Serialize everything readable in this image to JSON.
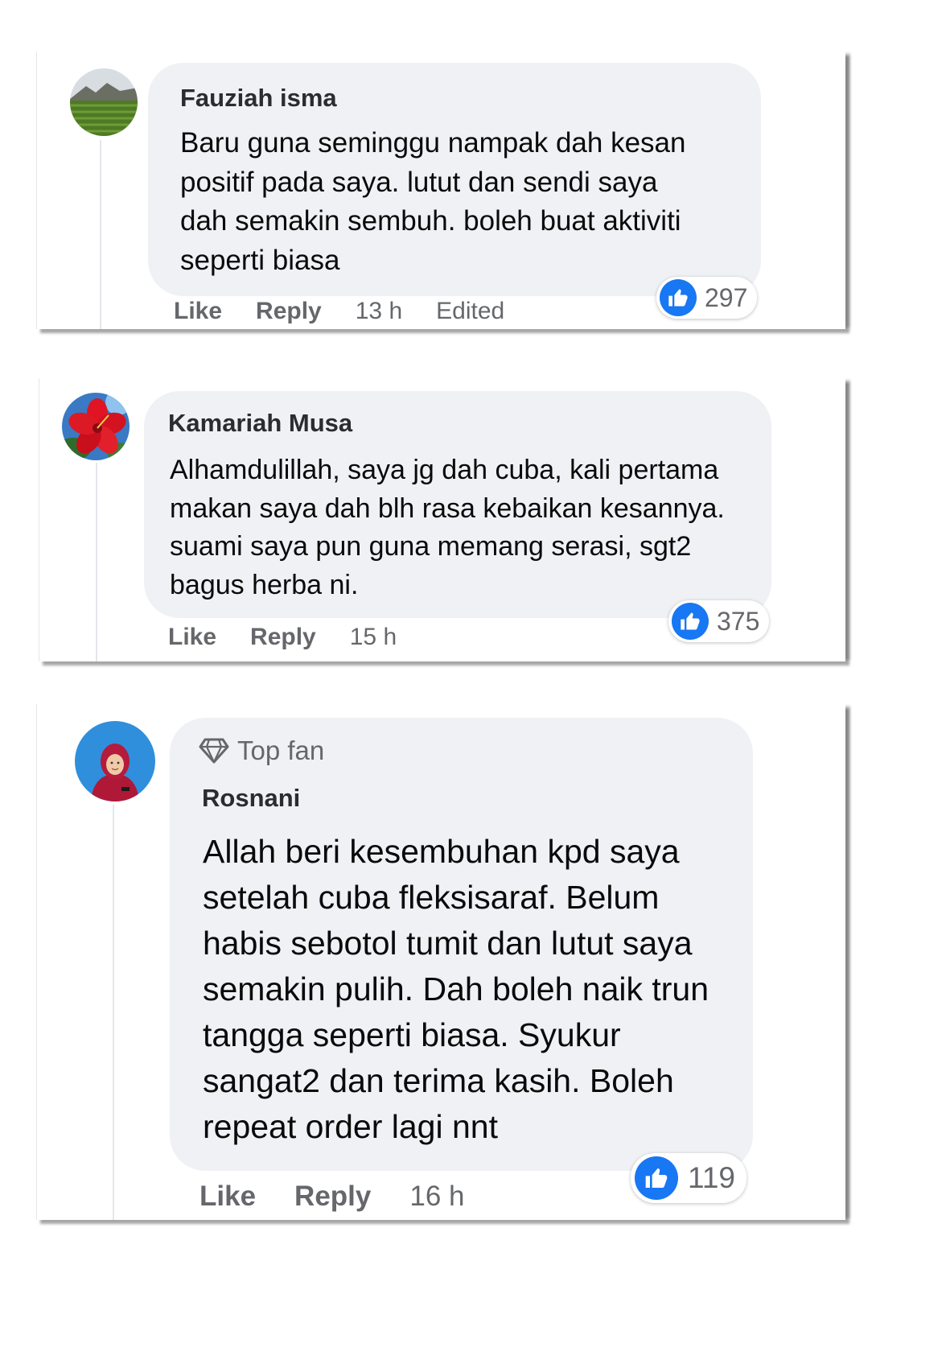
{
  "colors": {
    "bubble": "#eff1f4",
    "like_blue": "#1877f2",
    "meta_gray": "#65676b"
  },
  "comments": [
    {
      "name": "Fauziah isma",
      "text": "Baru guna seminggu nampak dah kesan\npositif pada saya. lutut dan sendi saya\ndah semakin sembuh. boleh buat aktiviti\nseperti biasa",
      "like_label": "Like",
      "reply_label": "Reply",
      "time": "13 h",
      "edited": "Edited",
      "reactions": "297",
      "reaction_icon": "thumbs-up-icon",
      "avatar": "field-landscape-avatar"
    },
    {
      "name": "Kamariah Musa",
      "text": "Alhamdulillah, saya jg dah cuba, kali pertama\nmakan saya dah blh rasa kebaikan kesannya.\nsuami saya pun guna memang serasi, sgt2\nbagus herba ni.",
      "like_label": "Like",
      "reply_label": "Reply",
      "time": "15 h",
      "reactions": "375",
      "reaction_icon": "thumbs-up-icon",
      "avatar": "hibiscus-flower-avatar"
    },
    {
      "badge_icon": "diamond-icon",
      "badge": "Top fan",
      "name": "Rosnani",
      "text": "Allah beri kesembuhan kpd saya\nsetelah cuba fleksisaraf. Belum\nhabis sebotol tumit dan lutut saya\nsemakin pulih. Dah boleh naik trun\ntangga seperti biasa. Syukur\nsangat2 dan terima kasih. Boleh\nrepeat order lagi nnt",
      "like_label": "Like",
      "reply_label": "Reply",
      "time": "16 h",
      "reactions": "119",
      "reaction_icon": "thumbs-up-icon",
      "avatar": "woman-hijab-avatar"
    }
  ]
}
